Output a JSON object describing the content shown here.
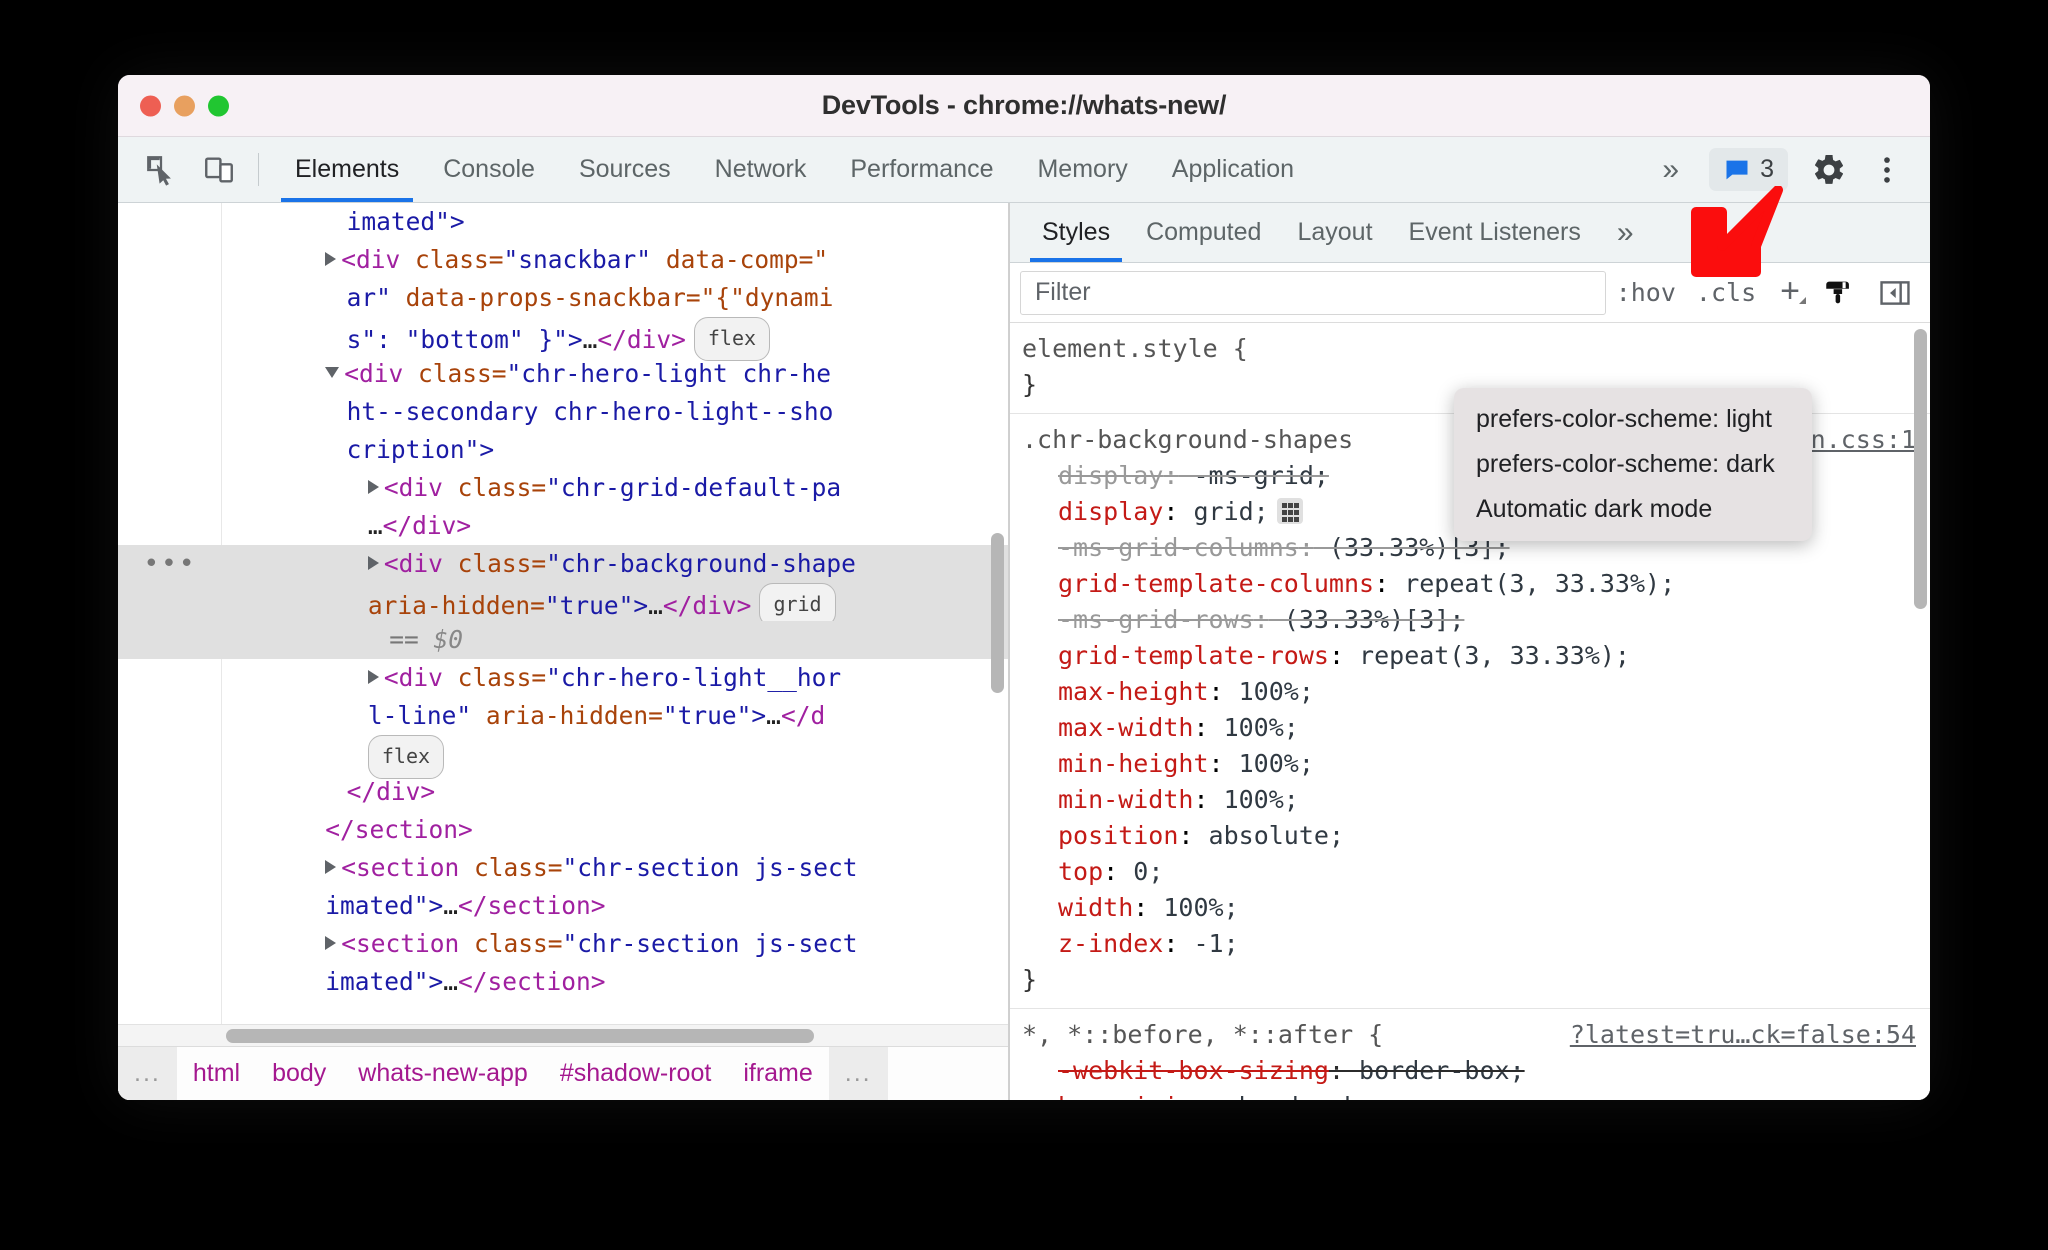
{
  "window": {
    "title": "DevTools - chrome://whats-new/",
    "traffic_lights": [
      "close",
      "minimize",
      "maximize"
    ]
  },
  "toolbar": {
    "inspect_icon": "inspect-cursor-icon",
    "device_icon": "device-toolbar-icon",
    "more_tabs_label": "»",
    "issues_count": "3",
    "issues_icon": "issues-message-icon",
    "settings_icon": "gear-icon",
    "kebab_icon": "more-options-icon"
  },
  "main_tabs": [
    {
      "label": "Elements",
      "active": true
    },
    {
      "label": "Console",
      "active": false
    },
    {
      "label": "Sources",
      "active": false
    },
    {
      "label": "Network",
      "active": false
    },
    {
      "label": "Performance",
      "active": false
    },
    {
      "label": "Memory",
      "active": false
    },
    {
      "label": "Application",
      "active": false
    }
  ],
  "dom_tree": {
    "lines": [
      {
        "indent": 5,
        "parts": [
          {
            "t": "attrval",
            "s": "imated\">"
          }
        ]
      },
      {
        "indent": 4,
        "arrow": "closed",
        "parts": [
          {
            "t": "tag",
            "s": "<div "
          },
          {
            "t": "attrname",
            "s": "class="
          },
          {
            "t": "attrval",
            "s": "\"snackbar\""
          },
          {
            "t": "plain",
            "s": " "
          },
          {
            "t": "attrname",
            "s": "data-comp=\""
          }
        ]
      },
      {
        "indent": 5,
        "parts": [
          {
            "t": "attrval",
            "s": "ar\" "
          },
          {
            "t": "attrname",
            "s": "data-props-snackbar=\"{\"dynami"
          }
        ]
      },
      {
        "indent": 5,
        "parts": [
          {
            "t": "attrval",
            "s": "s\": \"bottom\" }\">"
          },
          {
            "t": "txtnode",
            "s": "…"
          },
          {
            "t": "tag",
            "s": "</div>"
          }
        ],
        "badge": "flex"
      },
      {
        "indent": 4,
        "arrow": "open",
        "parts": [
          {
            "t": "tag",
            "s": "<div "
          },
          {
            "t": "attrname",
            "s": "class="
          },
          {
            "t": "attrval",
            "s": "\"chr-hero-light chr-he"
          }
        ]
      },
      {
        "indent": 5,
        "parts": [
          {
            "t": "attrval",
            "s": "ht--secondary chr-hero-light--sho"
          }
        ]
      },
      {
        "indent": 5,
        "parts": [
          {
            "t": "attrval",
            "s": "cription\">"
          }
        ]
      },
      {
        "indent": 6,
        "arrow": "closed",
        "parts": [
          {
            "t": "tag",
            "s": "<div "
          },
          {
            "t": "attrname",
            "s": "class="
          },
          {
            "t": "attrval",
            "s": "\"chr-grid-default-pa"
          }
        ]
      },
      {
        "indent": 6,
        "parts": [
          {
            "t": "txtnode",
            "s": "…"
          },
          {
            "t": "tag",
            "s": "</div>"
          }
        ]
      },
      {
        "indent": 6,
        "arrow": "closed",
        "selected": true,
        "parts": [
          {
            "t": "tag",
            "s": "<div "
          },
          {
            "t": "attrname",
            "s": "class="
          },
          {
            "t": "attrval",
            "s": "\"chr-background-shape"
          }
        ]
      },
      {
        "indent": 6,
        "selected": true,
        "parts": [
          {
            "t": "attrname",
            "s": "aria-hidden="
          },
          {
            "t": "attrval",
            "s": "\"true\">"
          },
          {
            "t": "txtnode",
            "s": "…"
          },
          {
            "t": "tag",
            "s": "</div>"
          }
        ],
        "badge": "grid"
      },
      {
        "indent": 7,
        "selected": true,
        "parts": [
          {
            "t": "eq",
            "s": "== "
          },
          {
            "t": "dollar",
            "s": "$0"
          }
        ]
      },
      {
        "indent": 6,
        "arrow": "closed",
        "parts": [
          {
            "t": "tag",
            "s": "<div "
          },
          {
            "t": "attrname",
            "s": "class="
          },
          {
            "t": "attrval",
            "s": "\"chr-hero-light__hor"
          }
        ]
      },
      {
        "indent": 6,
        "parts": [
          {
            "t": "attrval",
            "s": "l-line\" "
          },
          {
            "t": "attrname",
            "s": "aria-hidden="
          },
          {
            "t": "attrval",
            "s": "\"true\">"
          },
          {
            "t": "txtnode",
            "s": "…"
          },
          {
            "t": "tag",
            "s": "</d"
          }
        ]
      },
      {
        "indent": 6,
        "badge_only": "flex",
        "parts": []
      },
      {
        "indent": 5,
        "parts": [
          {
            "t": "tag",
            "s": "</div>"
          }
        ]
      },
      {
        "indent": 4,
        "parts": [
          {
            "t": "tag",
            "s": "</section>"
          }
        ]
      },
      {
        "indent": 4,
        "arrow": "closed",
        "parts": [
          {
            "t": "tag",
            "s": "<section "
          },
          {
            "t": "attrname",
            "s": "class="
          },
          {
            "t": "attrval",
            "s": "\"chr-section js-sect"
          }
        ]
      },
      {
        "indent": 4,
        "parts": [
          {
            "t": "attrval",
            "s": "imated\">"
          },
          {
            "t": "txtnode",
            "s": "…"
          },
          {
            "t": "tag",
            "s": "</section>"
          }
        ]
      },
      {
        "indent": 4,
        "arrow": "closed",
        "parts": [
          {
            "t": "tag",
            "s": "<section "
          },
          {
            "t": "attrname",
            "s": "class="
          },
          {
            "t": "attrval",
            "s": "\"chr-section js-sect"
          }
        ]
      },
      {
        "indent": 4,
        "parts": [
          {
            "t": "attrval",
            "s": "imated\">"
          },
          {
            "t": "txtnode",
            "s": "…"
          },
          {
            "t": "tag",
            "s": "</section>"
          }
        ]
      }
    ]
  },
  "breadcrumb": {
    "left_ellipsis": "...",
    "items": [
      "html",
      "body",
      "whats-new-app",
      "#shadow-root",
      "iframe"
    ],
    "right_ellipsis": "..."
  },
  "styles_tabs": [
    {
      "label": "Styles",
      "active": true
    },
    {
      "label": "Computed",
      "active": false
    },
    {
      "label": "Layout",
      "active": false
    },
    {
      "label": "Event Listeners",
      "active": false
    }
  ],
  "styles_tabs_more": "»",
  "styles_toolbar": {
    "filter_placeholder": "Filter",
    "filter_value": "",
    "hov_label": ":hov",
    "cls_label": ".cls",
    "new_rule_label": "+",
    "render_emulation_icon": "paintbrush-icon",
    "toggle_sidebar_icon": "toggle-right-panel-icon"
  },
  "emulation_menu": {
    "items": [
      "prefers-color-scheme: light",
      "prefers-color-scheme: dark",
      "Automatic dark mode"
    ]
  },
  "styles_rules": [
    {
      "selector": "element.style {",
      "source": "",
      "declarations": [],
      "close": "}"
    },
    {
      "selector": ".chr-background-shapes",
      "source": "n.css:1",
      "declarations": [
        {
          "prop": "display",
          "value": " -ms-grid;",
          "struck": true,
          "strike_all": true
        },
        {
          "prop": "display",
          "value": " grid;",
          "struck": false,
          "chip": "grid-editor-icon"
        },
        {
          "prop": "-ms-grid-columns",
          "value": " (33.33%)[3];",
          "struck": true,
          "strike_all": true
        },
        {
          "prop": "grid-template-columns",
          "value": " repeat(3, 33.33%);",
          "struck": false
        },
        {
          "prop": "-ms-grid-rows",
          "value": " (33.33%)[3];",
          "struck": true,
          "strike_all": true
        },
        {
          "prop": "grid-template-rows",
          "value": " repeat(3, 33.33%);",
          "struck": false
        },
        {
          "prop": "max-height",
          "value": " 100%;",
          "struck": false
        },
        {
          "prop": "max-width",
          "value": " 100%;",
          "struck": false
        },
        {
          "prop": "min-height",
          "value": " 100%;",
          "struck": false
        },
        {
          "prop": "min-width",
          "value": " 100%;",
          "struck": false
        },
        {
          "prop": "position",
          "value": " absolute;",
          "struck": false
        },
        {
          "prop": "top",
          "value": " 0;",
          "struck": false
        },
        {
          "prop": "width",
          "value": " 100%;",
          "struck": false
        },
        {
          "prop": "z-index",
          "value": " -1;",
          "struck": false
        }
      ],
      "close": "}"
    },
    {
      "selector": "*, *::before, *::after {",
      "source": "?latest=tru…ck=false:54",
      "declarations": [
        {
          "prop": "-webkit-box-sizing",
          "value": " border-box;",
          "struck": true,
          "strike_all": true,
          "red": true
        },
        {
          "prop": "box-sizing",
          "value": " border-box;",
          "struck": false,
          "red": true
        }
      ],
      "close": ""
    }
  ],
  "annotation": {
    "arrow_color": "#fb0d0d",
    "arrow_label": "down-left-arrow-annotation"
  }
}
